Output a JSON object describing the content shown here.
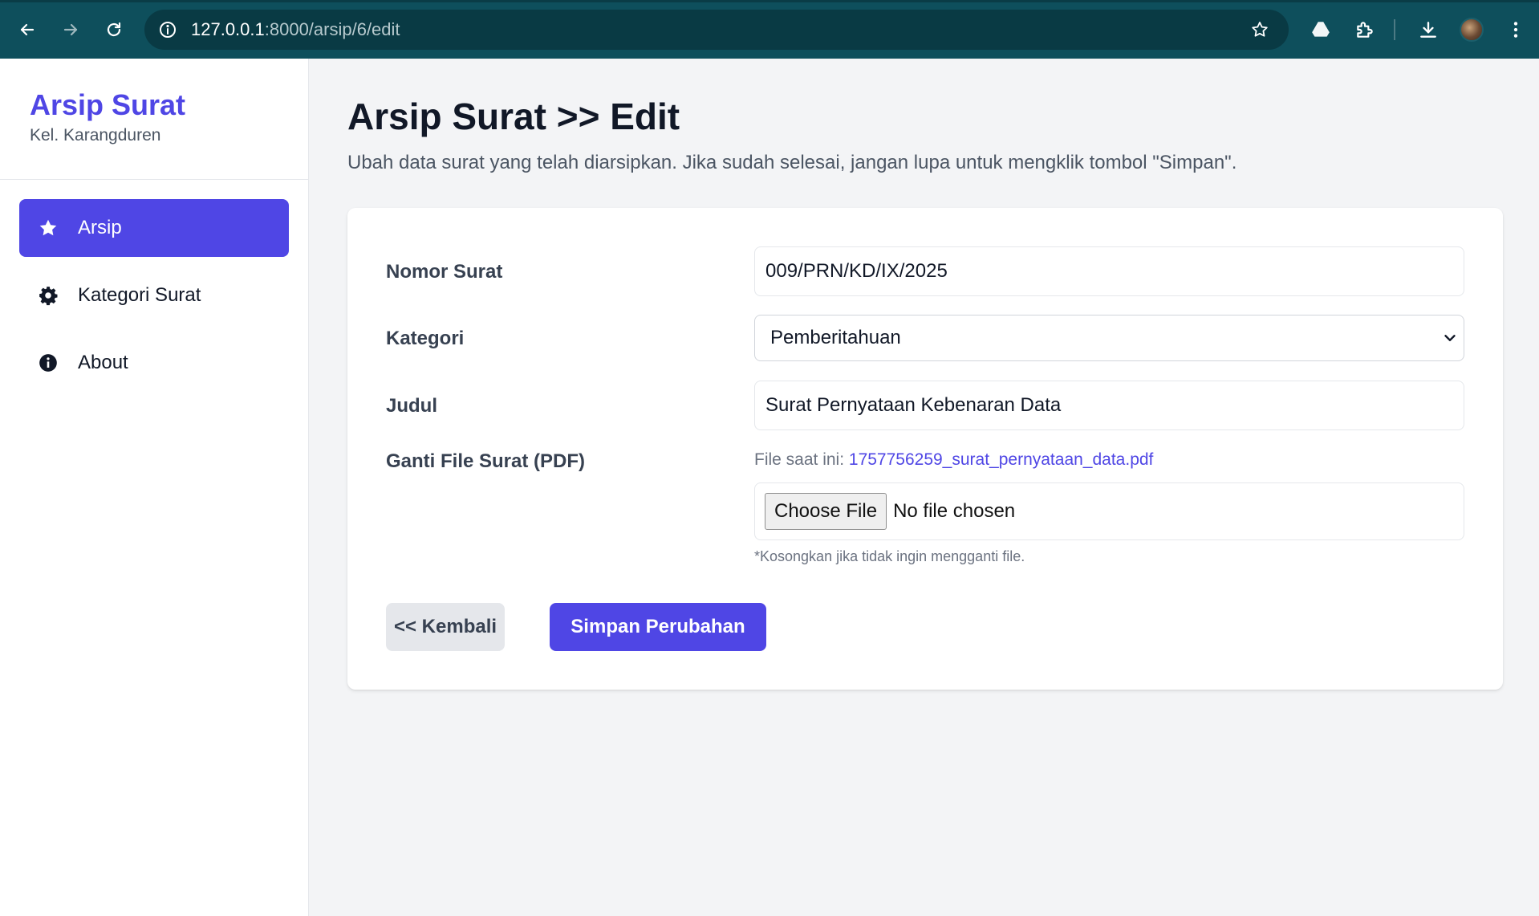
{
  "browser": {
    "url_host": "127.0.0.1",
    "url_path": ":8000/arsip/6/edit"
  },
  "sidebar": {
    "brand_title": "Arsip Surat",
    "brand_subtitle": "Kel. Karangduren",
    "items": [
      {
        "label": "Arsip",
        "icon": "star-icon",
        "active": true
      },
      {
        "label": "Kategori Surat",
        "icon": "gear-icon",
        "active": false
      },
      {
        "label": "About",
        "icon": "info-icon",
        "active": false
      }
    ]
  },
  "main": {
    "title": "Arsip Surat >> Edit",
    "description": "Ubah data surat yang telah diarsipkan. Jika sudah selesai, jangan lupa untuk mengklik tombol \"Simpan\".",
    "form": {
      "nomor_label": "Nomor Surat",
      "nomor_value": "009/PRN/KD/IX/2025",
      "kategori_label": "Kategori",
      "kategori_value": "Pemberitahuan",
      "judul_label": "Judul",
      "judul_value": "Surat Pernyataan Kebenaran Data",
      "file_label": "Ganti File Surat (PDF)",
      "file_current_prefix": "File saat ini:",
      "file_current_name": "1757756259_surat_pernyataan_data.pdf",
      "choose_file_label": "Choose File",
      "no_file_label": "No file chosen",
      "file_hint": "*Kosongkan jika tidak ingin mengganti file."
    },
    "buttons": {
      "back_label": "<< Kembali",
      "save_label": "Simpan Perubahan"
    }
  },
  "colors": {
    "accent": "#4f46e5",
    "browser_bar": "#0e4f5c"
  }
}
